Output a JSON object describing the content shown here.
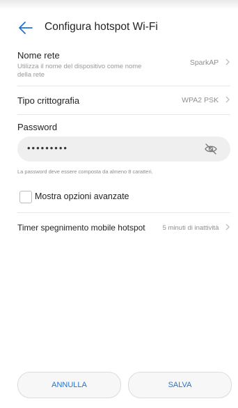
{
  "header": {
    "title": "Configura hotspot Wi-Fi",
    "back_icon": "back-arrow-icon"
  },
  "settings": {
    "network_name": {
      "label": "Nome rete",
      "description": "Utilizza il nome del dispositivo come nome della rete",
      "value": "SparkAP"
    },
    "encryption": {
      "label": "Tipo crittografia",
      "value": "WPA2 PSK"
    },
    "password": {
      "label": "Password",
      "value": "•••••••••",
      "hint": "La password deve essere composta da almeno 8 caratteri."
    },
    "advanced": {
      "label": "Mostra opzioni avanzate",
      "checked": false
    },
    "timer": {
      "label": "Timer spegnimento mobile hotspot",
      "value": "5 minuti di inattività"
    }
  },
  "buttons": {
    "cancel": "ANNULLA",
    "save": "SALVA"
  },
  "colors": {
    "accent": "#1f73d2",
    "field_bg": "#efefef",
    "divider": "#e6e6e6"
  }
}
